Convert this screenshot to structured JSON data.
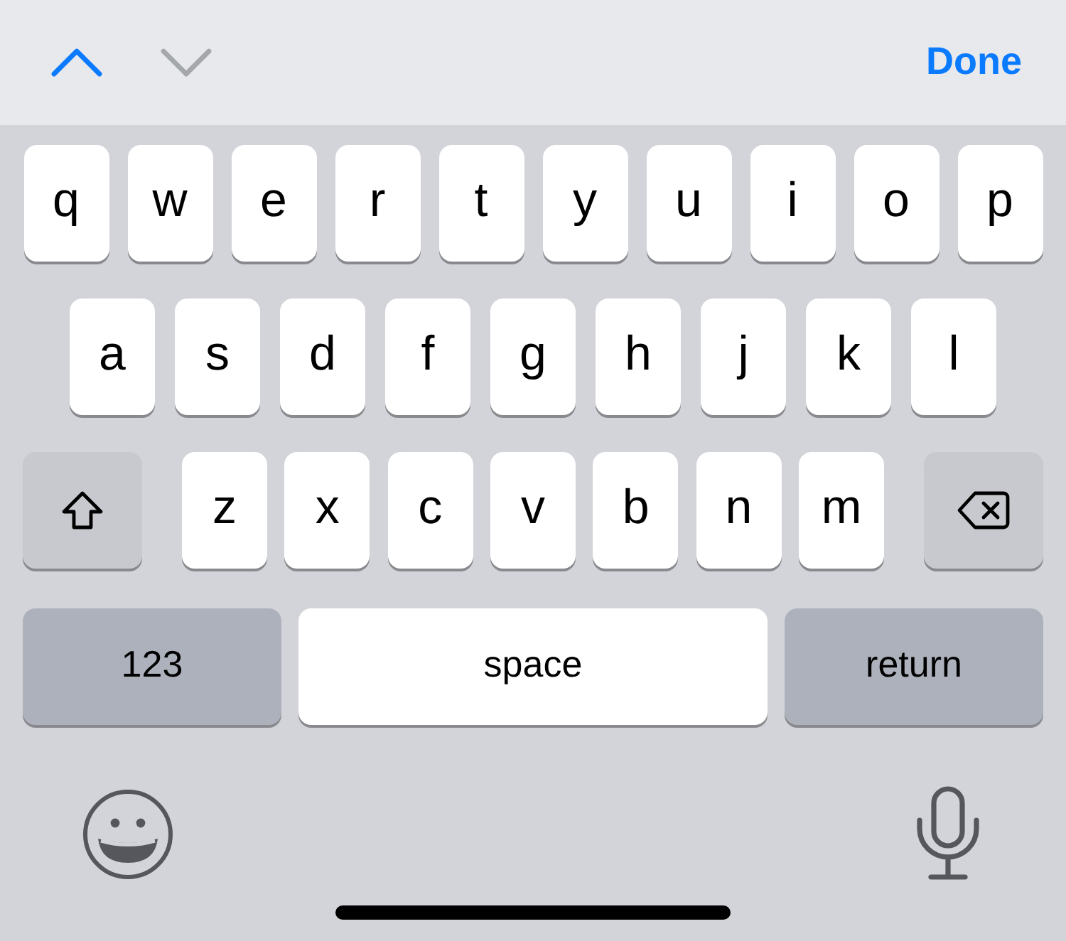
{
  "toolbar": {
    "nav": [
      {
        "kind": "previous",
        "disabled": false
      },
      {
        "kind": "next",
        "disabled": true
      }
    ],
    "done": "Done"
  },
  "keyboard": {
    "rows": [
      {
        "keys": [
          {
            "kind": "letter",
            "label": "q"
          },
          {
            "kind": "letter",
            "label": "w"
          },
          {
            "kind": "letter",
            "label": "e"
          },
          {
            "kind": "letter",
            "label": "r"
          },
          {
            "kind": "letter",
            "label": "t"
          },
          {
            "kind": "letter",
            "label": "y"
          },
          {
            "kind": "letter",
            "label": "u"
          },
          {
            "kind": "letter",
            "label": "i"
          },
          {
            "kind": "letter",
            "label": "o"
          },
          {
            "kind": "letter",
            "label": "p"
          }
        ]
      },
      {
        "keys": [
          {
            "kind": "letter",
            "label": "a"
          },
          {
            "kind": "letter",
            "label": "s"
          },
          {
            "kind": "letter",
            "label": "d"
          },
          {
            "kind": "letter",
            "label": "f"
          },
          {
            "kind": "letter",
            "label": "g"
          },
          {
            "kind": "letter",
            "label": "h"
          },
          {
            "kind": "letter",
            "label": "j"
          },
          {
            "kind": "letter",
            "label": "k"
          },
          {
            "kind": "letter",
            "label": "l"
          }
        ]
      },
      {
        "keys": [
          {
            "kind": "shift",
            "on": false
          },
          {
            "kind": "letter",
            "label": "z"
          },
          {
            "kind": "letter",
            "label": "x"
          },
          {
            "kind": "letter",
            "label": "c"
          },
          {
            "kind": "letter",
            "label": "v"
          },
          {
            "kind": "letter",
            "label": "b"
          },
          {
            "kind": "letter",
            "label": "n"
          },
          {
            "kind": "letter",
            "label": "m"
          },
          {
            "kind": "delete"
          }
        ]
      },
      {
        "keys": [
          {
            "kind": "mode",
            "label": "123"
          },
          {
            "kind": "space",
            "label": "space"
          },
          {
            "kind": "return",
            "label": "return"
          }
        ]
      }
    ]
  }
}
